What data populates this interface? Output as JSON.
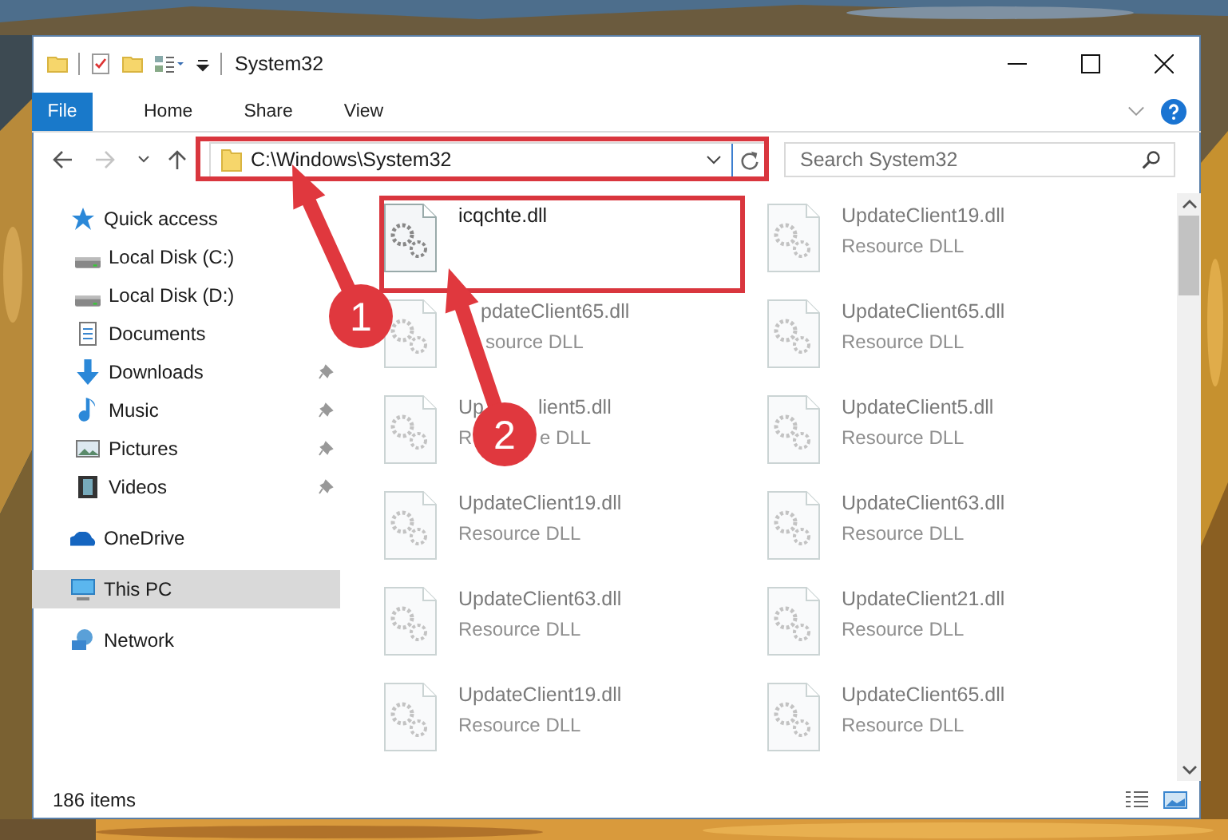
{
  "window": {
    "title": "System32"
  },
  "ribbon": {
    "file_tab": "File",
    "tabs": [
      {
        "label": "Home"
      },
      {
        "label": "Share"
      },
      {
        "label": "View"
      }
    ]
  },
  "address": {
    "path": "C:\\Windows\\System32",
    "search_placeholder": "Search System32"
  },
  "sidebar": {
    "items": [
      {
        "label": "Quick access",
        "selected": false,
        "children": [
          {
            "label": "Local Disk (C:)",
            "pinned": false
          },
          {
            "label": "Local Disk (D:)",
            "pinned": false
          },
          {
            "label": "Documents",
            "pinned": false
          },
          {
            "label": "Downloads",
            "pinned": true
          },
          {
            "label": "Music",
            "pinned": true
          },
          {
            "label": "Pictures",
            "pinned": true
          },
          {
            "label": "Videos",
            "pinned": true
          }
        ]
      },
      {
        "label": "OneDrive",
        "selected": false
      },
      {
        "label": "This PC",
        "selected": true
      },
      {
        "label": "Network",
        "selected": false
      }
    ]
  },
  "files": [
    {
      "name": "icqchte.dll",
      "faded": false
    },
    {
      "name": "UpdateClient19.dll",
      "type": "Resource DLL",
      "faded": true
    },
    {
      "name": "pdateClient65.dll",
      "type": "source DLL",
      "faded": true
    },
    {
      "name": "UpdateClient65.dll",
      "type": "Resource DLL",
      "faded": true
    },
    {
      "name": "Up",
      "name_rest": "lient5.dll",
      "type": "R",
      "type_rest": "e DLL",
      "faded": true
    },
    {
      "name": "UpdateClient5.dll",
      "type": "Resource DLL",
      "faded": true
    },
    {
      "name": "UpdateClient19.dll",
      "type": "Resource DLL",
      "faded": true
    },
    {
      "name": "UpdateClient63.dll",
      "type": "Resource DLL",
      "faded": true
    },
    {
      "name": "UpdateClient63.dll",
      "type": "Resource DLL",
      "faded": true
    },
    {
      "name": "UpdateClient21.dll",
      "type": "Resource DLL",
      "faded": true
    },
    {
      "name": "UpdateClient19.dll",
      "type": "Resource DLL",
      "faded": true
    },
    {
      "name": "UpdateClient65.dll",
      "type": "Resource DLL",
      "faded": true
    }
  ],
  "status_bar": {
    "item_count": "186 items"
  },
  "annotations": [
    {
      "number": "1"
    },
    {
      "number": "2"
    }
  ]
}
